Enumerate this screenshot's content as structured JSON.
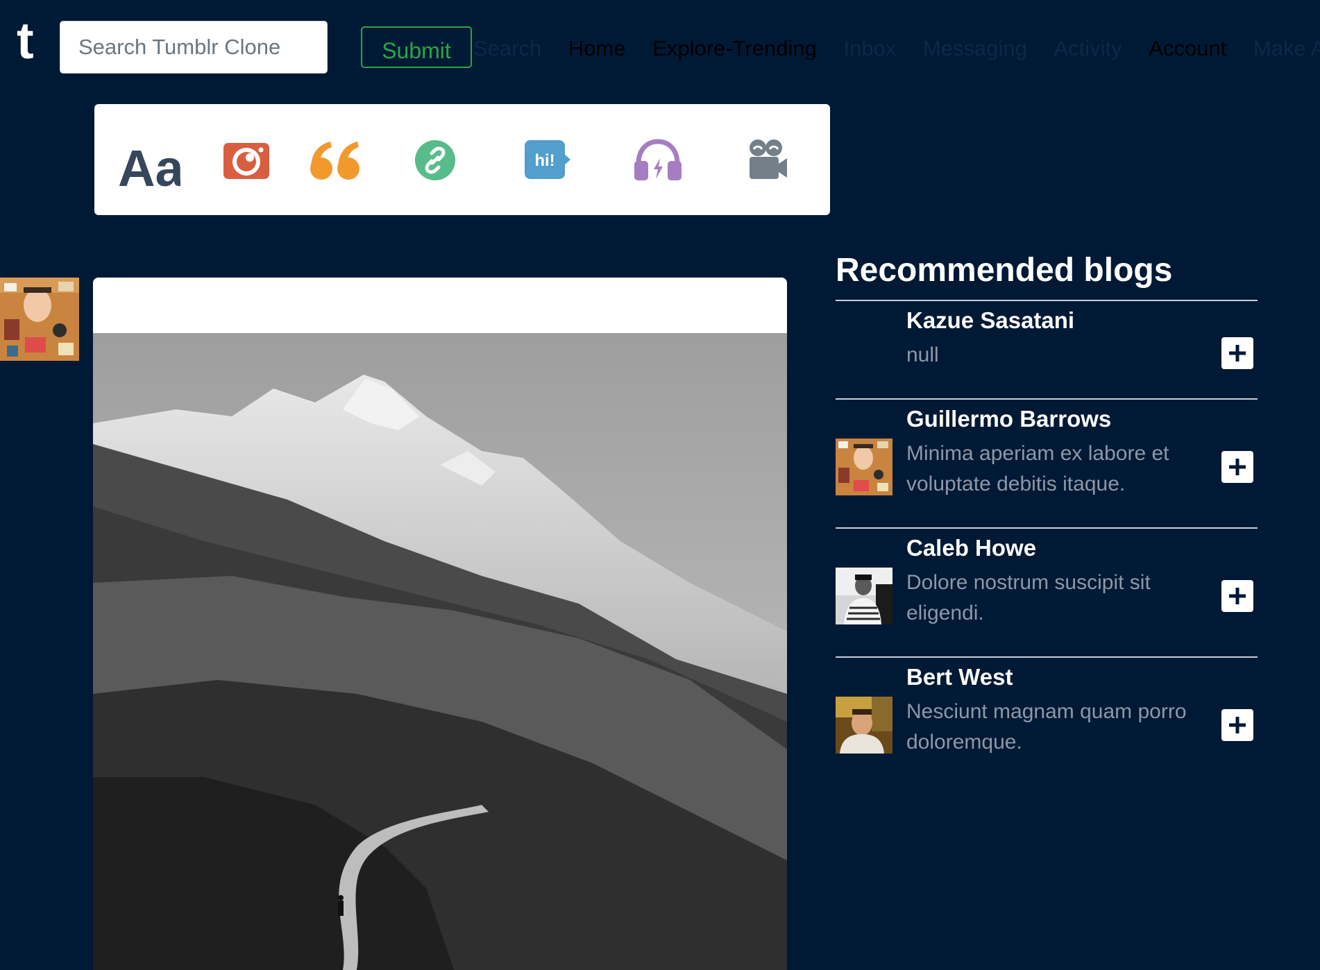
{
  "navbar": {
    "logo": "t",
    "search_placeholder": "Search Tumblr Clone",
    "search_value": "",
    "submit_label": "Submit",
    "links": [
      {
        "label": "Search",
        "style": "muted"
      },
      {
        "label": "Home",
        "style": "dark"
      },
      {
        "label": "Explore-Trending",
        "style": "dark"
      },
      {
        "label": "Inbox",
        "style": "muted"
      },
      {
        "label": "Messaging",
        "style": "muted"
      },
      {
        "label": "Activity",
        "style": "muted"
      },
      {
        "label": "Account",
        "style": "dark"
      },
      {
        "label": "Make A",
        "style": "muted"
      }
    ]
  },
  "post_types": [
    {
      "name": "text",
      "icon": "text-icon",
      "label": "Aa",
      "color": "#36465d"
    },
    {
      "name": "photo",
      "icon": "camera-icon",
      "color": "#d95e40"
    },
    {
      "name": "quote",
      "icon": "quote-icon",
      "color": "#f2992e"
    },
    {
      "name": "link",
      "icon": "link-icon",
      "color": "#56bc8a"
    },
    {
      "name": "chat",
      "icon": "chat-icon",
      "label": "hi!",
      "color": "#529ecc"
    },
    {
      "name": "audio",
      "icon": "headphones-icon",
      "color": "#a77dc2"
    },
    {
      "name": "video",
      "icon": "video-camera-icon",
      "color": "#748089"
    }
  ],
  "sidebar": {
    "title": "Recommended blogs",
    "blogs": [
      {
        "name": "Kazue Sasatani",
        "description": "null",
        "avatar": "none"
      },
      {
        "name": "Guillermo Barrows",
        "description": "Minima aperiam ex labore et voluptate debitis itaque.",
        "avatar": "flatlay-portrait"
      },
      {
        "name": "Caleb Howe",
        "description": "Dolore nostrum suscipit sit eligendi.",
        "avatar": "bw-portrait"
      },
      {
        "name": "Bert West",
        "description": "Nesciunt magnam quam porro doloremque.",
        "avatar": "warm-portrait"
      }
    ]
  },
  "colors": {
    "background": "#001935",
    "submit_green": "#28a745",
    "muted_text": "#8d98a6"
  }
}
